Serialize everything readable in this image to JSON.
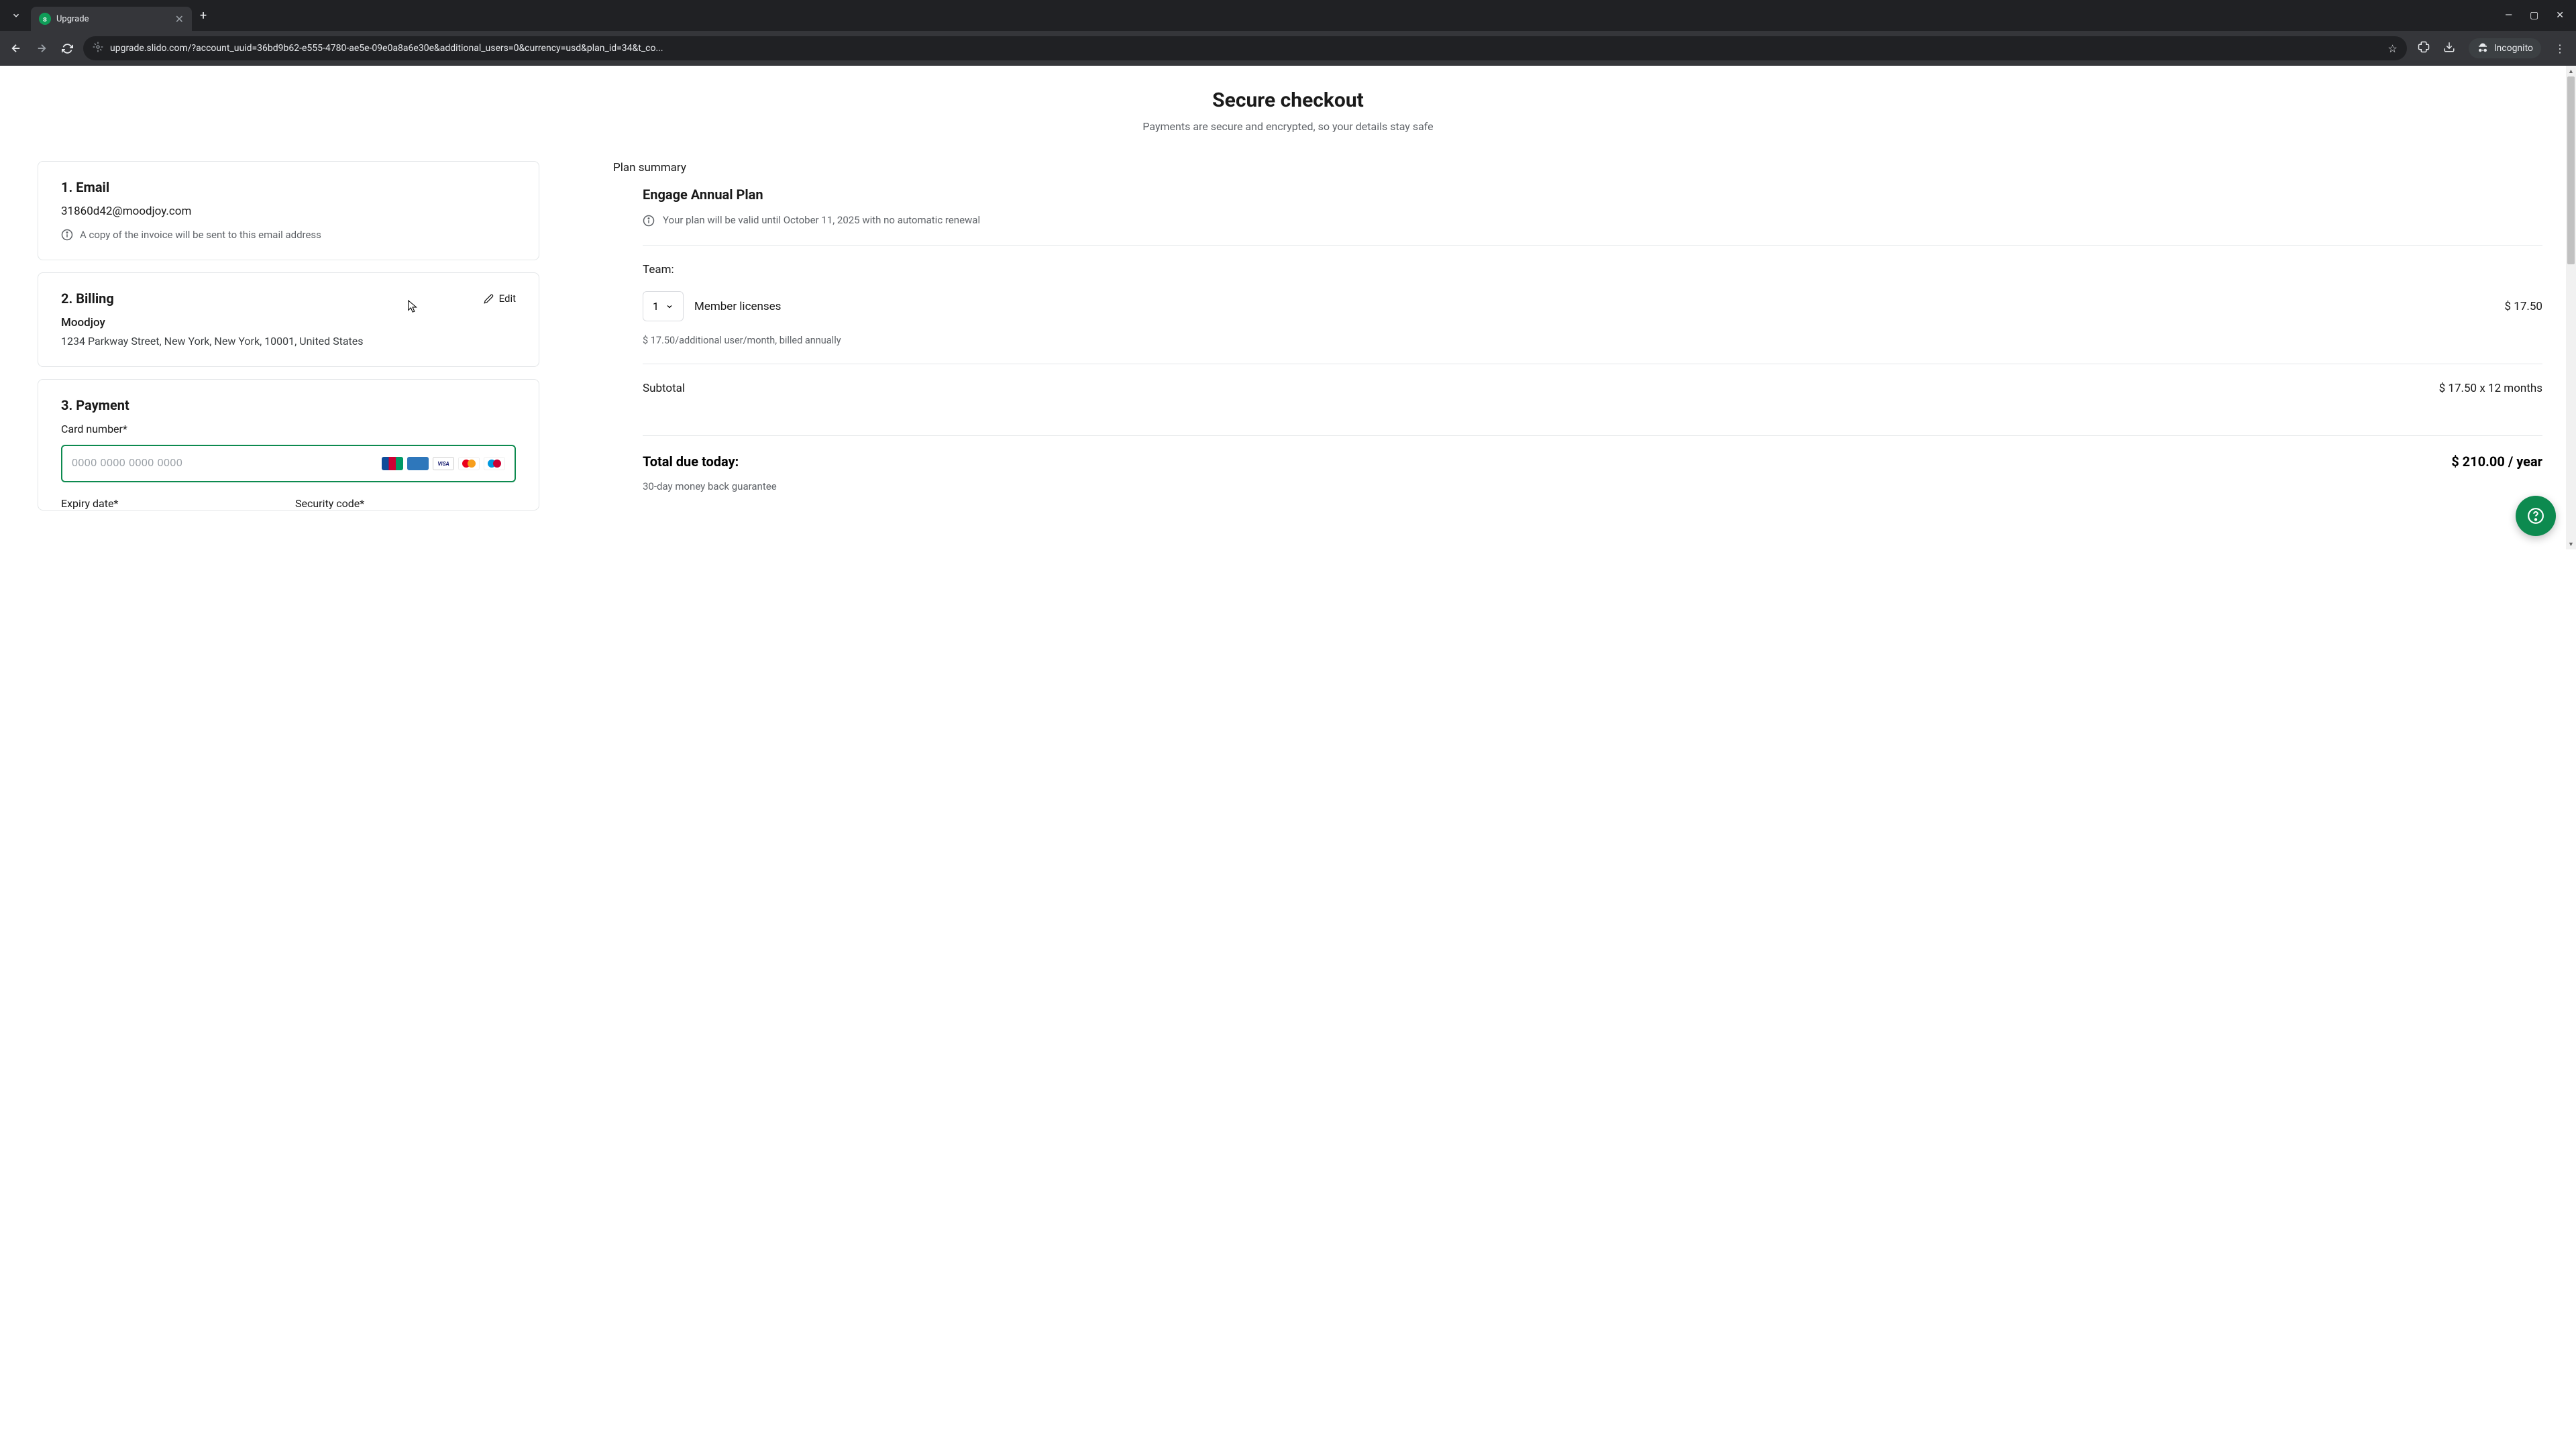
{
  "browser": {
    "tab_title": "Upgrade",
    "url": "upgrade.slido.com/?account_uuid=36bd9b62-e555-4780-ae5e-09e0a8a6e30e&additional_users=0&currency=usd&plan_id=34&t_co...",
    "incognito": "Incognito"
  },
  "header": {
    "title": "Secure checkout",
    "subtitle": "Payments are secure and encrypted, so your details stay safe"
  },
  "email": {
    "title": "1. Email",
    "value": "31860d42@moodjoy.com",
    "note": "A copy of the invoice will be sent to this email address"
  },
  "billing": {
    "title": "2. Billing",
    "edit": "Edit",
    "name": "Moodjoy",
    "address": "1234 Parkway Street, New York, New York, 10001, United States"
  },
  "payment": {
    "title": "3. Payment",
    "card_label": "Card number*",
    "card_placeholder": "0000 0000 0000 0000",
    "expiry_label": "Expiry date*",
    "cvc_label": "Security code*"
  },
  "summary": {
    "heading": "Plan summary",
    "plan_name": "Engage Annual Plan",
    "validity": "Your plan will be valid until October 11, 2025 with no automatic renewal",
    "team_label": "Team:",
    "qty": "1",
    "license_label": "Member licenses",
    "license_price": "$ 17.50",
    "price_note": "$ 17.50/additional user/month, billed annually",
    "subtotal_label": "Subtotal",
    "subtotal_value": "$ 17.50 x 12 months",
    "total_label": "Total due today:",
    "total_value": "$ 210.00 / year",
    "guarantee": "30-day money back guarantee"
  }
}
